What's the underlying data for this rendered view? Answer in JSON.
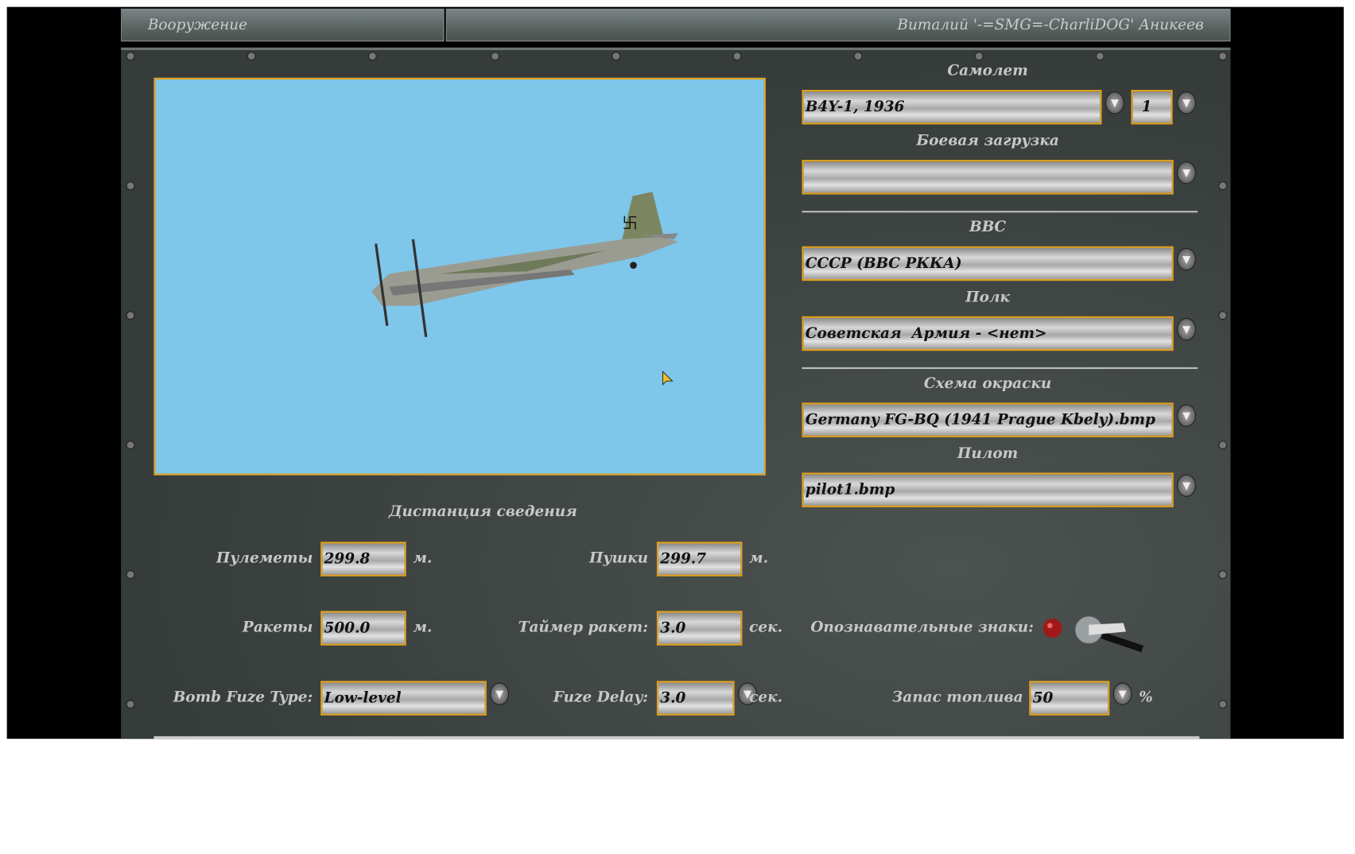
{
  "header": {
    "tab_title": "Вооружение",
    "user_name": "Виталий '-=SMG=-CharliDOG' Аникеев"
  },
  "aircraft": {
    "label": "Самолет",
    "value": "B4Y-1, 1936",
    "count": "1"
  },
  "loadout": {
    "label": "Боевая загрузка",
    "value": ""
  },
  "airforce": {
    "label": "ВВС",
    "value": "СССР (ВВС РККА)"
  },
  "regiment": {
    "label": "Полк",
    "value": "Советская  Армия - <нет>"
  },
  "skin": {
    "label": "Схема окраски",
    "value": "Germany FG-BQ (1941 Prague Kbely).bmp"
  },
  "pilot": {
    "label": "Пилот",
    "value": "pilot1.bmp"
  },
  "convergence": {
    "title": "Дистанция сведения",
    "mg_label": "Пулеметы",
    "mg_value": "299.8",
    "mg_unit": "м.",
    "cannon_label": "Пушки",
    "cannon_value": "299.7",
    "cannon_unit": "м.",
    "rocket_label": "Ракеты",
    "rocket_value": "500.0",
    "rocket_unit": "м.",
    "rocket_timer_label": "Таймер ракет:",
    "rocket_timer_value": "3.0",
    "rocket_timer_unit": "сек.",
    "markings_label": "Опознавательные знаки:",
    "bomb_fuze_label": "Bomb Fuze Type:",
    "bomb_fuze_value": "Low-level",
    "fuze_delay_label": "Fuze Delay:",
    "fuze_delay_value": "3.0",
    "fuze_delay_unit": "сек.",
    "fuel_label": "Запас топлива",
    "fuel_value": "50",
    "fuel_unit": "%"
  },
  "colors": {
    "accent": "#e0a020",
    "preview_bg": "#7ec6ea",
    "panel": "#3c4340"
  }
}
